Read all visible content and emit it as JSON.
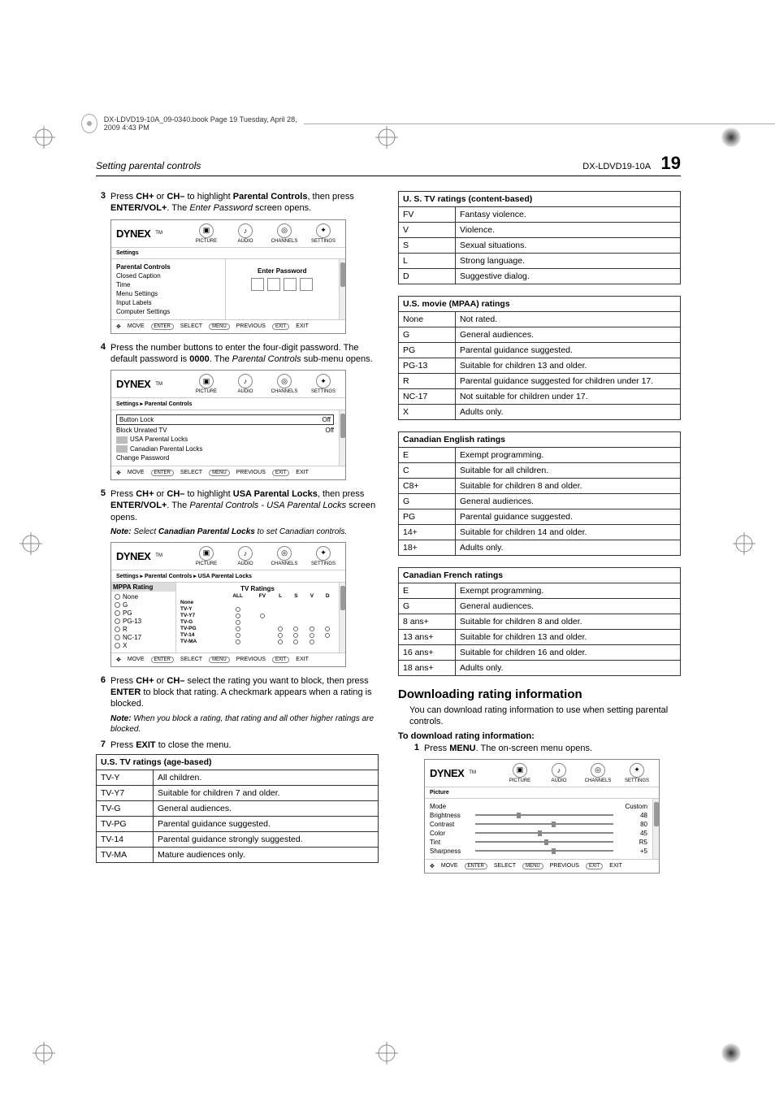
{
  "topbar_text": "DX-LDVD19-10A_09-0340.book  Page 19  Tuesday, April 28, 2009  4:43 PM",
  "header": {
    "left": "Setting parental controls",
    "model": "DX-LDVD19-10A",
    "page": "19"
  },
  "steps": {
    "s3": {
      "n": "3",
      "t1": "Press ",
      "b1": "CH+",
      "t2": " or ",
      "b2": "CH–",
      "t3": " to highlight ",
      "b3": "Parental Controls",
      "t4": ", then press ",
      "b4": "ENTER/VOL+",
      "t5": ". The ",
      "i1": "Enter Password",
      "t6": " screen opens."
    },
    "s4": {
      "n": "4",
      "t1": "Press the number buttons to enter the four-digit password. The default password is ",
      "b1": "0000",
      "t2": ". The ",
      "i1": "Parental Controls",
      "t3": " sub-menu opens."
    },
    "s5": {
      "n": "5",
      "t1": "Press ",
      "b1": "CH+",
      "t2": " or ",
      "b2": "CH–",
      "t3": " to highlight ",
      "b3": "USA Parental Locks",
      "t4": ", then press ",
      "b4": "ENTER/VOL+",
      "t5": ". The ",
      "i1": "Parental Controls - USA Parental Locks",
      "t6": " screen opens."
    },
    "note5": {
      "label": "Note:",
      "t1": " Select ",
      "b1": "Canadian Parental Locks",
      "t2": " to set Canadian controls."
    },
    "s6": {
      "n": "6",
      "t1": "Press ",
      "b1": "CH+",
      "t2": " or ",
      "b2": "CH–",
      "t3": " select the rating you want to block, then press ",
      "b3": "ENTER",
      "t4": " to block that rating. A checkmark appears when a rating is blocked."
    },
    "note6": {
      "label": "Note:",
      "t": " When you block a rating, that rating and all other higher ratings are blocked."
    },
    "s7": {
      "n": "7",
      "t1": "Press ",
      "b1": "EXIT",
      "t2": " to close the menu."
    }
  },
  "osd": {
    "logo": "DYNEX",
    "tm": "TM",
    "tabs": {
      "pic": "PICTURE",
      "aud": "AUDIO",
      "ch": "CHANNELS",
      "set": "SETTINGS"
    },
    "crumb1": "Settings",
    "crumb2": "Settings ▸ Parental Controls",
    "crumb3": "Settings ▸ Parental Controls ▸ USA Parental Locks",
    "crumb_pic": "Picture",
    "settings_items": [
      "Parental Controls",
      "Closed Caption",
      "Time",
      "Menu Settings",
      "Input Labels",
      "Computer Settings"
    ],
    "enter_pw": "Enter Password",
    "pc_rows": [
      {
        "l": "Button Lock",
        "r": "Off",
        "boxed": true
      },
      {
        "l": "Block Unrated TV",
        "r": "Off"
      },
      {
        "l": "USA Parental Locks",
        "flag": true
      },
      {
        "l": "Canadian Parental Locks",
        "flag": true
      },
      {
        "l": "Change Password"
      }
    ],
    "mppa_title": "MPPA Rating",
    "mppa": [
      "None",
      "G",
      "PG",
      "PG-13",
      "R",
      "NC-17",
      "X"
    ],
    "tvr_title": "TV Ratings",
    "tvr_cols": [
      "ALL",
      "FV",
      "L",
      "S",
      "V",
      "D"
    ],
    "tvr_rows": [
      "None",
      "TV-Y",
      "TV-Y7",
      "TV-G",
      "TV-PG",
      "TV-14",
      "TV-MA"
    ],
    "picture_rows": [
      {
        "l": "Mode",
        "v": "Custom",
        "noslider": true
      },
      {
        "l": "Brightness",
        "v": "48",
        "pos": 30
      },
      {
        "l": "Contrast",
        "v": "80",
        "pos": 55
      },
      {
        "l": "Color",
        "v": "45",
        "pos": 45
      },
      {
        "l": "Tint",
        "v": "R5",
        "pos": 50
      },
      {
        "l": "Sharpness",
        "v": "+5",
        "pos": 55
      }
    ],
    "footer": {
      "move": "MOVE",
      "select": "SELECT",
      "prev": "PREVIOUS",
      "exit": "EXIT",
      "k_enter": "ENTER",
      "k_menu": "MENU",
      "k_exit": "EXIT"
    }
  },
  "tables": {
    "us_age": {
      "title": "U.S. TV ratings (age-based)",
      "rows": [
        [
          "TV-Y",
          "All children."
        ],
        [
          "TV-Y7",
          "Suitable for children 7 and older."
        ],
        [
          "TV-G",
          "General audiences."
        ],
        [
          "TV-PG",
          "Parental guidance suggested."
        ],
        [
          "TV-14",
          "Parental guidance strongly suggested."
        ],
        [
          "TV-MA",
          "Mature audiences only."
        ]
      ]
    },
    "us_content": {
      "title": "U. S. TV ratings (content-based)",
      "rows": [
        [
          "FV",
          "Fantasy violence."
        ],
        [
          "V",
          "Violence."
        ],
        [
          "S",
          "Sexual situations."
        ],
        [
          "L",
          "Strong language."
        ],
        [
          "D",
          "Suggestive dialog."
        ]
      ]
    },
    "mpaa": {
      "title": "U.S. movie (MPAA) ratings",
      "rows": [
        [
          "None",
          "Not rated."
        ],
        [
          "G",
          "General audiences."
        ],
        [
          "PG",
          "Parental guidance suggested."
        ],
        [
          "PG-13",
          "Suitable for children 13 and older."
        ],
        [
          "R",
          "Parental guidance suggested for children under 17."
        ],
        [
          "NC-17",
          "Not suitable for children under 17."
        ],
        [
          "X",
          "Adults only."
        ]
      ]
    },
    "can_en": {
      "title": "Canadian English ratings",
      "rows": [
        [
          "E",
          "Exempt programming."
        ],
        [
          "C",
          "Suitable for all children."
        ],
        [
          "C8+",
          "Suitable for children 8 and older."
        ],
        [
          "G",
          "General audiences."
        ],
        [
          "PG",
          "Parental guidance suggested."
        ],
        [
          "14+",
          "Suitable for children 14 and older."
        ],
        [
          "18+",
          "Adults only."
        ]
      ]
    },
    "can_fr": {
      "title": "Canadian French ratings",
      "rows": [
        [
          "E",
          "Exempt programming."
        ],
        [
          "G",
          "General audiences."
        ],
        [
          "8 ans+",
          "Suitable for children 8 and older."
        ],
        [
          "13 ans+",
          "Suitable for children 13 and older."
        ],
        [
          "16 ans+",
          "Suitable for children 16 and older."
        ],
        [
          "18 ans+",
          "Adults only."
        ]
      ]
    }
  },
  "download": {
    "heading": "Downloading rating information",
    "para": "You can download rating information to use when setting parental controls.",
    "sub": "To download rating information:",
    "s1": {
      "n": "1",
      "t1": "Press ",
      "b1": "MENU",
      "t2": ". The on-screen menu opens."
    }
  }
}
